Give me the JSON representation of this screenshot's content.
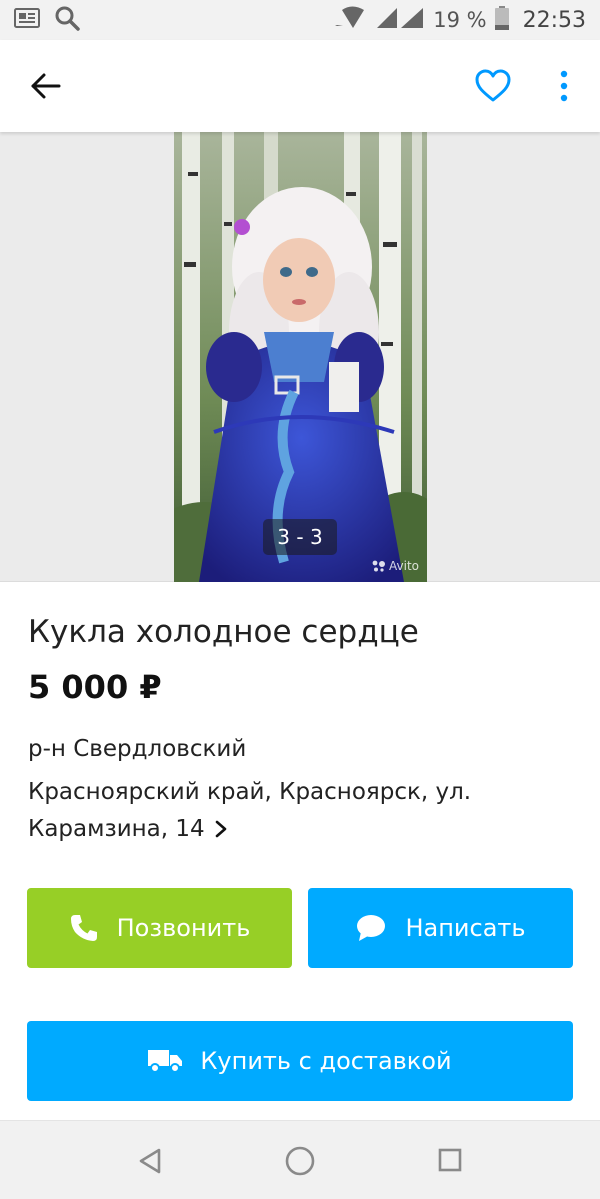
{
  "status_bar": {
    "battery": "19 %",
    "time": "22:53",
    "icons": [
      "news-icon",
      "search-icon",
      "wifi-icon",
      "signal-icon",
      "battery-icon"
    ]
  },
  "app_bar": {
    "icons": [
      "back-arrow-icon",
      "heart-icon",
      "more-vert-icon"
    ],
    "accent": "#0099ff"
  },
  "gallery": {
    "counter": "3 - 3",
    "watermark": "Avito"
  },
  "listing": {
    "title": "Кукла холодное сердце",
    "price": "5 000 ₽",
    "district": "р-н Свердловский",
    "address": "Красноярский край, Красноярск, ул. Карамзина, 14"
  },
  "actions": {
    "call_label": "Позвонить",
    "write_label": "Написать",
    "buy_label": "Купить с доставкой",
    "colors": {
      "call": "#97cf26",
      "write": "#00aaff",
      "buy": "#00aaff"
    }
  },
  "nav_bar": {
    "icons": [
      "nav-back-icon",
      "nav-home-icon",
      "nav-recents-icon"
    ]
  }
}
